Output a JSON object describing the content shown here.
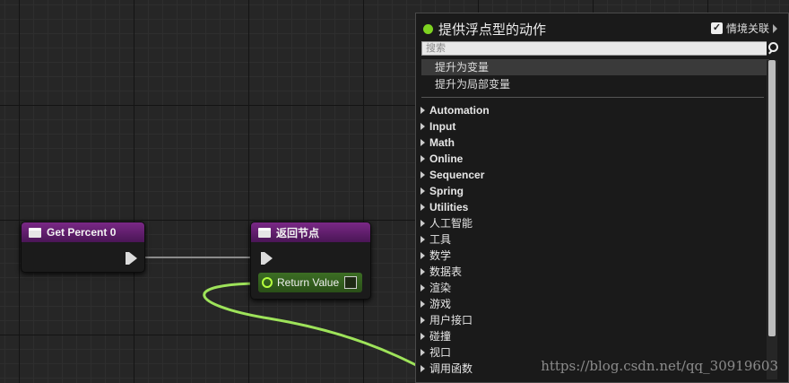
{
  "nodes": {
    "get_percent": {
      "title": "Get Percent 0"
    },
    "return_node": {
      "title": "返回节点",
      "pin_label": "Return Value"
    }
  },
  "menu": {
    "title": "提供浮点型的动作",
    "context_label": "情境关联",
    "context_checked": true,
    "search_placeholder": "搜索",
    "promote_items": [
      "提升为变量",
      "提升为局部变量"
    ],
    "categories": [
      "Automation",
      "Input",
      "Math",
      "Online",
      "Sequencer",
      "Spring",
      "Utilities",
      "人工智能",
      "工具",
      "数学",
      "数据表",
      "渲染",
      "游戏",
      "用户接口",
      "碰撞",
      "视口",
      "调用函数"
    ]
  },
  "watermark": "https://blog.csdn.net/qq_30919603",
  "colors": {
    "node_header": "#6a1f78",
    "float_pin": "#b5ff3d",
    "accent_dot": "#7ed321"
  }
}
